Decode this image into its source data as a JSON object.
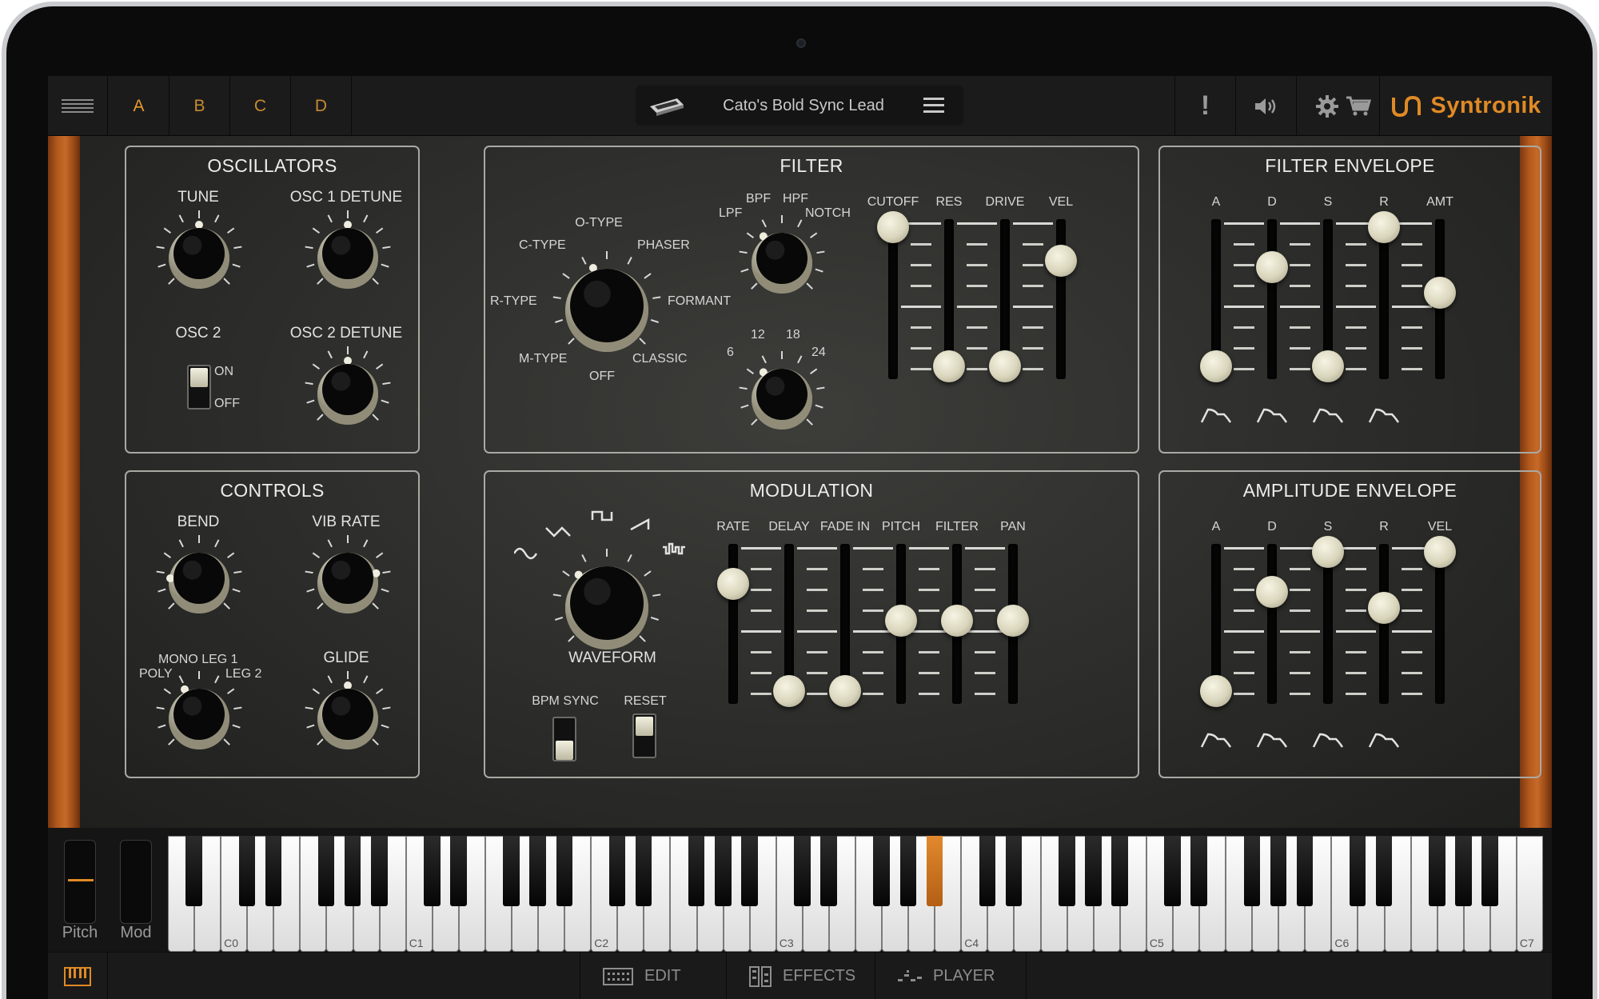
{
  "topbar": {
    "slot_tabs": [
      "A",
      "B",
      "C",
      "D"
    ],
    "preset_name": "Cato's Bold Sync Lead",
    "brand": "Syntronik",
    "alert_label": "!"
  },
  "oscillators": {
    "title": "OSCILLATORS",
    "tune": "TUNE",
    "osc1_detune": "OSC 1 DETUNE",
    "osc2": "OSC 2",
    "osc2_on": "ON",
    "osc2_off": "OFF",
    "osc2_detune": "OSC 2 DETUNE"
  },
  "filter": {
    "title": "FILTER",
    "types": {
      "o_type": "O-TYPE",
      "c_type": "C-TYPE",
      "phaser": "PHASER",
      "r_type": "R-TYPE",
      "formant": "FORMANT",
      "m_type": "M-TYPE",
      "classic": "CLASSIC",
      "off": "OFF"
    },
    "modes": {
      "bpf": "BPF",
      "hpf": "HPF",
      "lpf": "LPF",
      "notch": "NOTCH"
    },
    "slopes": {
      "s6": "6",
      "s12": "12",
      "s18": "18",
      "s24": "24"
    },
    "sliders": [
      "CUTOFF",
      "RES",
      "DRIVE",
      "VEL"
    ]
  },
  "filter_envelope": {
    "title": "FILTER ENVELOPE",
    "sliders": [
      "A",
      "D",
      "S",
      "R",
      "AMT"
    ]
  },
  "controls": {
    "title": "CONTROLS",
    "bend": "BEND",
    "vib_rate": "VIB RATE",
    "mono_leg1": "MONO LEG 1",
    "poly": "POLY",
    "leg2": "LEG 2",
    "glide": "GLIDE"
  },
  "modulation": {
    "title": "MODULATION",
    "waveform": "WAVEFORM",
    "bpm_sync": "BPM SYNC",
    "reset": "RESET",
    "sliders": [
      "RATE",
      "DELAY",
      "FADE IN",
      "PITCH",
      "FILTER",
      "PAN"
    ]
  },
  "amplitude_envelope": {
    "title": "AMPLITUDE ENVELOPE",
    "sliders": [
      "A",
      "D",
      "S",
      "R",
      "VEL"
    ]
  },
  "keyboard": {
    "pitch_label": "Pitch",
    "mod_label": "Mod",
    "octave_labels": [
      "C0",
      "C1",
      "C2",
      "C3",
      "C4",
      "C5",
      "C6",
      "C7"
    ]
  },
  "bottombar": {
    "edit": "EDIT",
    "effects": "EFFECTS",
    "player": "PLAYER"
  },
  "colors": {
    "accent": "#e08a25",
    "panel_line": "#a9a9a4"
  }
}
